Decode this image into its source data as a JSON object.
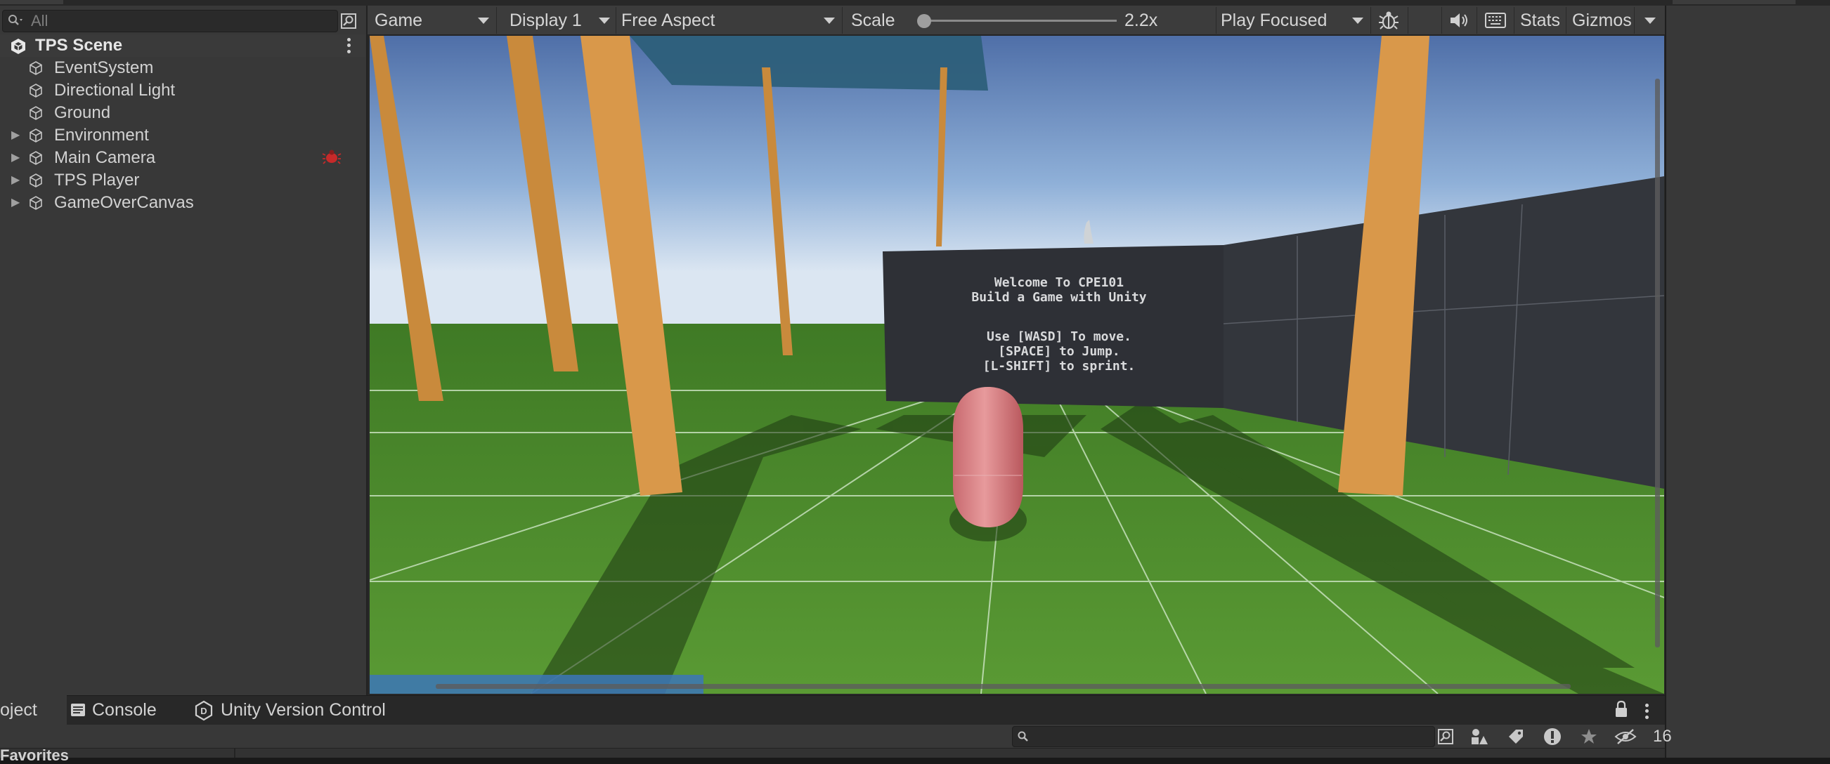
{
  "hierarchy": {
    "search_placeholder": "All",
    "scene_name": "TPS Scene",
    "items": [
      {
        "label": "EventSystem",
        "expandable": false
      },
      {
        "label": "Directional Light",
        "expandable": false
      },
      {
        "label": "Ground",
        "expandable": false
      },
      {
        "label": "Environment",
        "expandable": true
      },
      {
        "label": "Main Camera",
        "expandable": true
      },
      {
        "label": "TPS Player",
        "expandable": true
      },
      {
        "label": "GameOverCanvas",
        "expandable": true
      }
    ]
  },
  "game_toolbar": {
    "view_label": "Game",
    "display_label": "Display 1",
    "aspect_label": "Free Aspect",
    "scale_label": "Scale",
    "scale_value": "2.2x",
    "scale_slider_fraction": 0.02,
    "play_mode_label": "Play Focused",
    "stats_label": "Stats",
    "gizmos_label": "Gizmos"
  },
  "game_view": {
    "sign_lines": [
      "Welcome To CPE101",
      "Build a Game with Unity",
      "",
      "Use [WASD] To move.",
      "[SPACE] to Jump.",
      "[L-SHIFT] to sprint."
    ],
    "colors": {
      "player": "#d9797d",
      "ground": "#4e8a2c",
      "pillar": "#c98a3c",
      "wall": "#2e3036",
      "sky_top": "#4f6fa8",
      "sky_horizon": "#dbe6f2"
    }
  },
  "bottom_tabs": [
    {
      "label": "oject",
      "icon": "folder-icon"
    },
    {
      "label": "Console",
      "icon": "console-icon"
    },
    {
      "label": "Unity Version Control",
      "icon": "version-control-icon"
    }
  ],
  "bottom_toolbar": {
    "hidden_count": "16",
    "favorites_label": "Favorites"
  }
}
